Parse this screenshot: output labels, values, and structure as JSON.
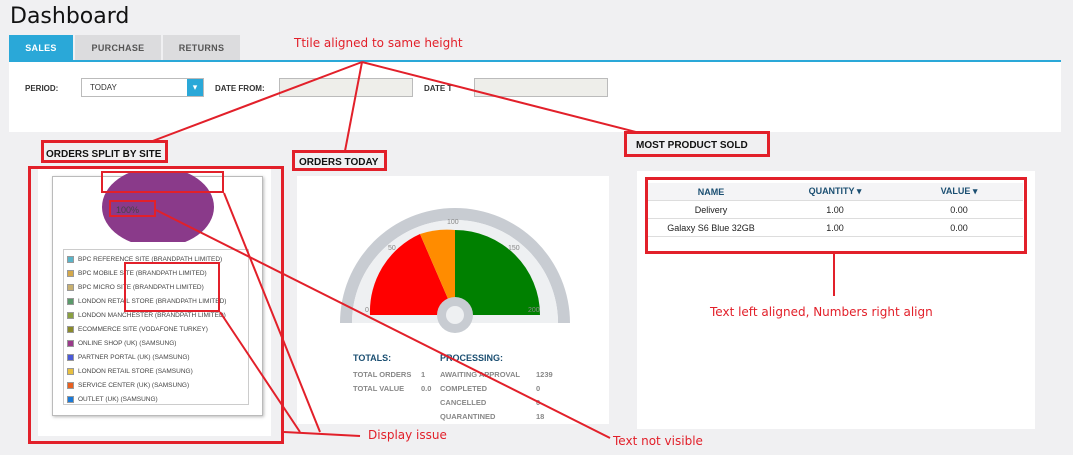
{
  "page": {
    "title": "Dashboard"
  },
  "tabs": [
    {
      "label": "SALES",
      "active": true
    },
    {
      "label": "PURCHASE",
      "active": false
    },
    {
      "label": "RETURNS",
      "active": false
    }
  ],
  "filters": {
    "period_label": "PERIOD:",
    "period_value": "TODAY",
    "date_from_label": "DATE FROM:",
    "date_to_label": "DATE T",
    "date_from_value": "",
    "date_to_value": ""
  },
  "orders_split": {
    "heading": "ORDERS SPLIT BY SITE",
    "pie_label": "100%",
    "legend": [
      {
        "label": "BPC REFERENCE SITE (BRANDPATH LIMITED)",
        "color": "#5ab4c8"
      },
      {
        "label": "BPC MOBILE SITE (BRANDPATH LIMITED)",
        "color": "#d4a84a"
      },
      {
        "label": "BPC MICRO SITE (BRANDPATH LIMITED)",
        "color": "#c8b070"
      },
      {
        "label": "LONDON RETAIL STORE (BRANDPATH LIMITED)",
        "color": "#5a9a6a"
      },
      {
        "label": "LONDON MANCHESTER (BRANDPATH LIMITED)",
        "color": "#8aa040"
      },
      {
        "label": "ECOMMERCE SITE (VODAFONE TURKEY)",
        "color": "#8a8a2a"
      },
      {
        "label": "ONLINE SHOP (UK) (SAMSUNG)",
        "color": "#9a3a8a"
      },
      {
        "label": "PARTNER PORTAL (UK) (SAMSUNG)",
        "color": "#4a5ad8"
      },
      {
        "label": "LONDON RETAIL STORE (SAMSUNG)",
        "color": "#e8c040"
      },
      {
        "label": "SERVICE CENTER (UK) (SAMSUNG)",
        "color": "#e86020"
      },
      {
        "label": "OUTLET (UK) (SAMSUNG)",
        "color": "#1a7ad8"
      }
    ]
  },
  "orders_today": {
    "heading": "ORDERS TODAY",
    "gauge_ticks": [
      "0",
      "50",
      "100",
      "150",
      "200"
    ],
    "totals_heading": "TOTALS:",
    "processing_heading": "PROCESSING:",
    "totals": [
      {
        "label": "TOTAL ORDERS",
        "value": "1"
      },
      {
        "label": "TOTAL VALUE",
        "value": "0.0"
      }
    ],
    "processing": [
      {
        "label": "AWAITING APPROVAL",
        "value": "1239"
      },
      {
        "label": "COMPLETED",
        "value": "0"
      },
      {
        "label": "CANCELLED",
        "value": "0"
      },
      {
        "label": "QUARANTINED",
        "value": "18"
      }
    ]
  },
  "most_sold": {
    "heading": "MOST PRODUCT SOLD",
    "columns": [
      "NAME",
      "QUANTITY ▾",
      "VALUE ▾"
    ],
    "rows": [
      [
        "Delivery",
        "1.00",
        "0.00"
      ],
      [
        "Galaxy S6 Blue 32GB",
        "1.00",
        "0.00"
      ]
    ]
  },
  "annotations": {
    "title_align": "Ttile aligned to same height",
    "text_align": "Text left aligned, Numbers right align",
    "display_issue": "Display issue",
    "text_not_visible": "Text not visible"
  },
  "colors": {
    "accent": "#2aa8d8",
    "annotation": "#e2202a"
  }
}
